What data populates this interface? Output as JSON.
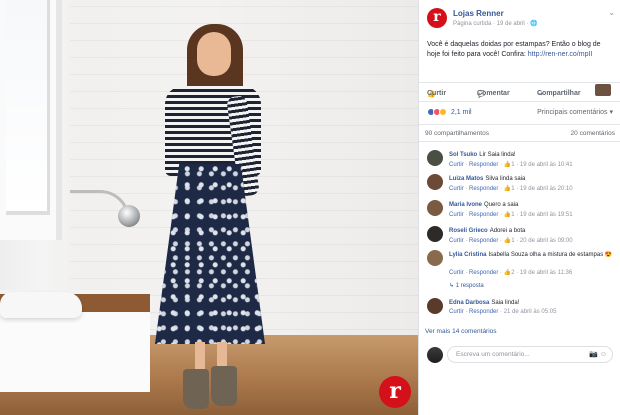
{
  "page": {
    "name": "Lojas Renner",
    "meta": "Página curtida · 19 de abril · ",
    "logo_letter": "r"
  },
  "post": {
    "text": "Você é daquelas doidas por estampas? Então o blog de hoje foi feito para você! Confira: ",
    "link": "http://ren-ner.co/mpII"
  },
  "actions": {
    "like": "Curtir",
    "comment": "Comentar",
    "share": "Compartilhar"
  },
  "reactions": {
    "count": "2,1 mil",
    "sort": "Principais comentários ▾"
  },
  "counts": {
    "shares": "90 compartilhamentos",
    "comments": "20 comentários"
  },
  "comments": [
    {
      "name": "Sol Tsuko",
      "text": "Lir Saia linda!",
      "likes": "1",
      "time": "19 de abril às 10:41",
      "avatar": "#4a4f43"
    },
    {
      "name": "Luiza Matos",
      "text": "Silva linda saia",
      "likes": "1",
      "time": "19 de abril às 20:10",
      "avatar": "#6b4a36"
    },
    {
      "name": "Maria Ivone",
      "text": "Quero a saia",
      "likes": "1",
      "time": "19 de abril às 19:51",
      "avatar": "#7b5a42"
    },
    {
      "name": "Roseli Grieco",
      "text": "Adorei a bota",
      "likes": "1",
      "time": "20 de abril às 09:00",
      "avatar": "#2d2a28"
    },
    {
      "name": "Lylia Cristina",
      "text": "Isabella Souza olha a mistura de estampas 😍",
      "likes": "2",
      "time": "19 de abril às 11:36",
      "avatar": "#8a6a4c",
      "replies": "1 resposta"
    },
    {
      "name": "Edna Darbosa",
      "text": "Saia linda!",
      "likes": "",
      "time": "21 de abril às 05:05",
      "avatar": "#5a3a2a"
    }
  ],
  "comment_actions": {
    "like": "Curtir",
    "reply": "Responder"
  },
  "see_more": "Ver mais 14 comentários",
  "writer": {
    "placeholder": "Escreva um comentário..."
  },
  "colors": {
    "brand_red": "#d4101b",
    "link_blue": "#365899",
    "like_blue": "#4267b2"
  }
}
